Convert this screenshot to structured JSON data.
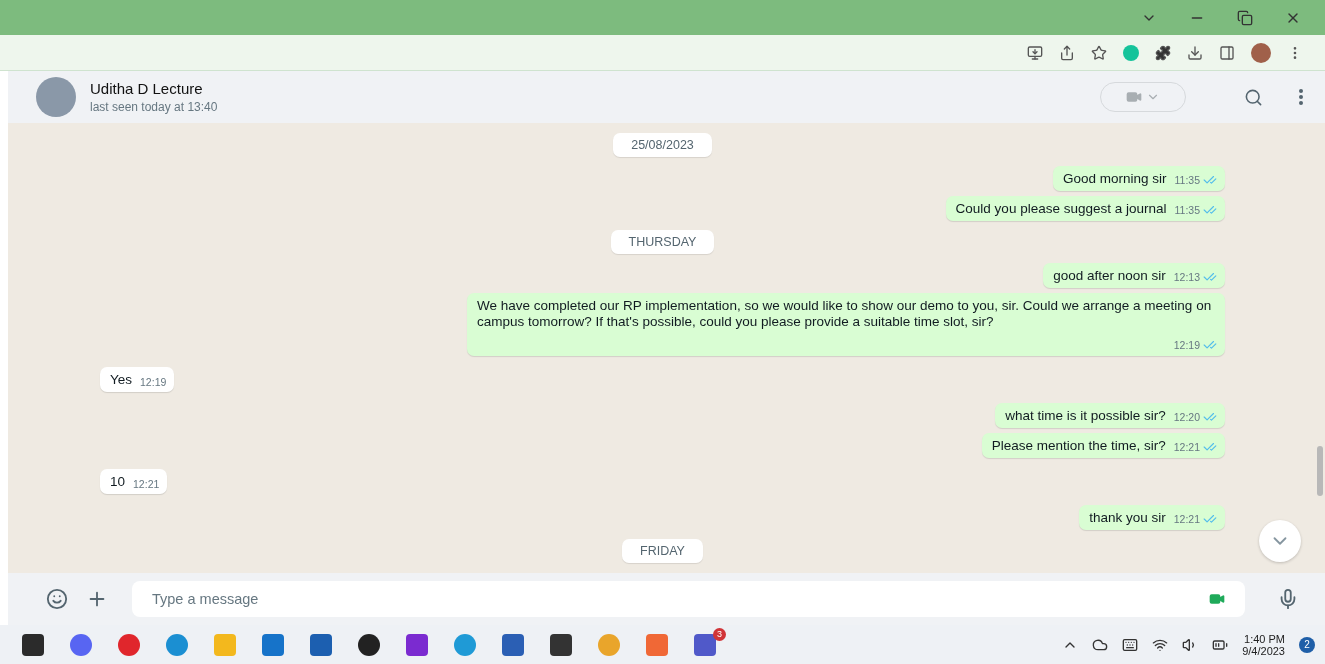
{
  "contact": {
    "name": "Uditha D Lecture",
    "status": "last seen today at 13:40"
  },
  "messages": [
    {
      "kind": "date",
      "text": "25/08/2023"
    },
    {
      "kind": "out",
      "text": "Good morning sir",
      "time": "11:35",
      "read": true
    },
    {
      "kind": "out",
      "text": "Could you please suggest a journal",
      "time": "11:35",
      "read": true
    },
    {
      "kind": "date",
      "text": "THURSDAY"
    },
    {
      "kind": "out",
      "text": "good after noon sir",
      "time": "12:13",
      "read": true
    },
    {
      "kind": "out",
      "text": "We have completed our RP implementation, so we would like to show our demo to you, sir. Could we arrange a meeting on campus tomorrow? If that's possible, could you please provide a suitable time slot, sir?",
      "time": "12:19",
      "read": true
    },
    {
      "kind": "in",
      "text": "Yes",
      "time": "12:19"
    },
    {
      "kind": "out",
      "text": "what time is it possible sir?",
      "time": "12:20",
      "read": true
    },
    {
      "kind": "out",
      "text": "Please mention the time, sir?",
      "time": "12:21",
      "read": true
    },
    {
      "kind": "in",
      "text": "10",
      "time": "12:21"
    },
    {
      "kind": "out",
      "text": "thank you sir",
      "time": "12:21",
      "read": true
    },
    {
      "kind": "date",
      "text": "FRIDAY"
    }
  ],
  "composer": {
    "placeholder": "Type a message"
  },
  "taskbar": {
    "teams_badge": "3",
    "time": "1:40 PM",
    "date": "9/4/2023",
    "notifications": "2"
  }
}
